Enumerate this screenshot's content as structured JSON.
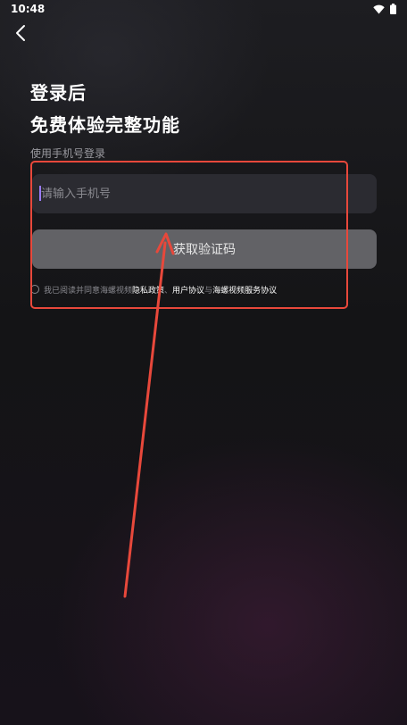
{
  "status_bar": {
    "time": "10:48"
  },
  "header": {
    "back_icon": "chevron-left-icon"
  },
  "headline": {
    "line1": "登录后",
    "line2": "免费体验完整功能"
  },
  "subtitle": "使用手机号登录",
  "phone_input": {
    "placeholder": "请输入手机号",
    "value": ""
  },
  "get_code_button": {
    "label": "获取验证码"
  },
  "agreement": {
    "prefix": "我已阅读并同意海螺视频",
    "privacy_policy": "隐私政策",
    "sep1": "、",
    "user_agreement": "用户协议",
    "sep2": "与",
    "service_agreement": "海螺视频服务协议",
    "checked": false
  },
  "colors": {
    "background": "#141416",
    "input_bg": "#2b2b31",
    "button_bg": "#626266",
    "annotation": "#e8483b",
    "caret": "#9b7cff"
  }
}
